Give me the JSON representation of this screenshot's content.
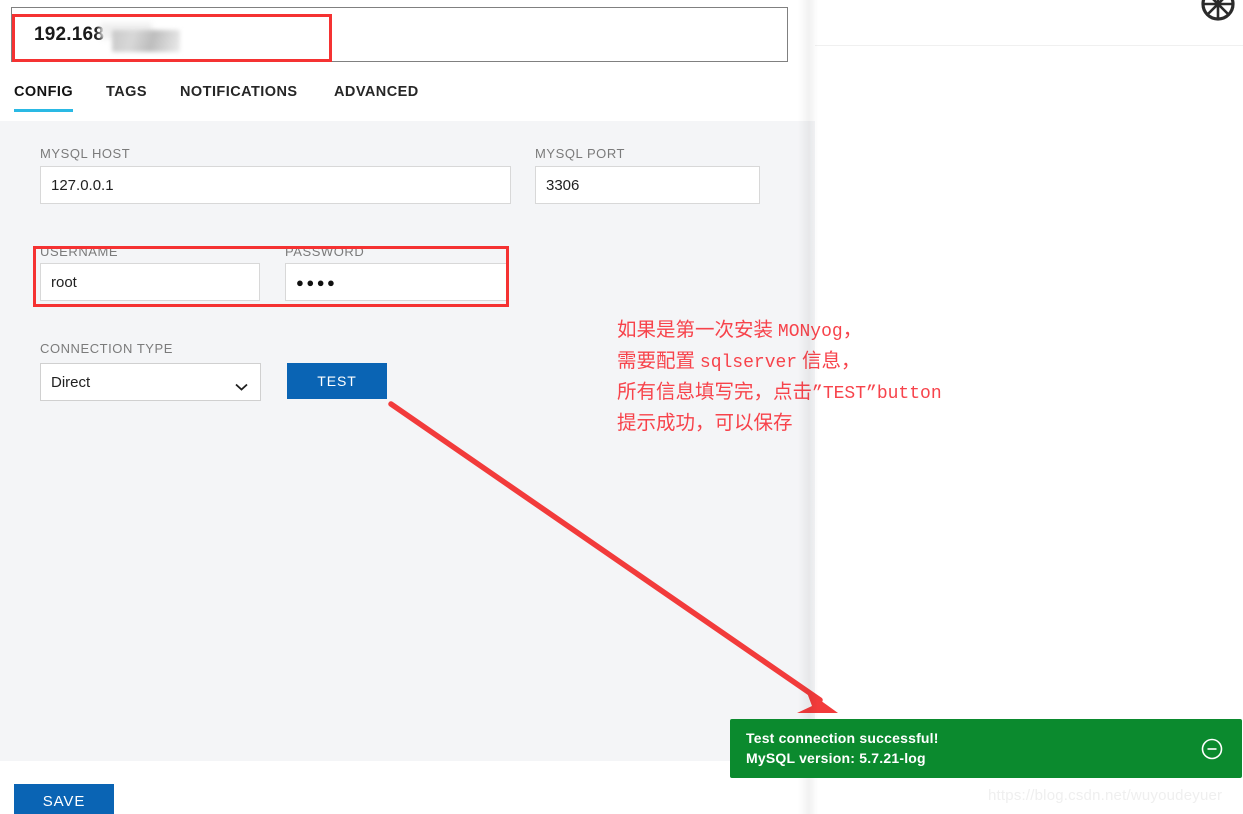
{
  "host_field": {
    "value": "192.168",
    "redacted": true
  },
  "tabs": [
    {
      "label": "CONFIG",
      "active": true
    },
    {
      "label": "TAGS",
      "active": false
    },
    {
      "label": "NOTIFICATIONS",
      "active": false
    },
    {
      "label": "ADVANCED",
      "active": false
    }
  ],
  "form": {
    "mysql_host": {
      "label": "MYSQL HOST",
      "value": "127.0.0.1"
    },
    "mysql_port": {
      "label": "MYSQL PORT",
      "value": "3306"
    },
    "username": {
      "label": "USERNAME",
      "value": "root"
    },
    "password": {
      "label": "PASSWORD",
      "value": "●●●●"
    },
    "connection_type": {
      "label": "CONNECTION TYPE",
      "value": "Direct"
    }
  },
  "buttons": {
    "test_label": "TEST",
    "save_label": "SAVE"
  },
  "annotation": {
    "line1_a": "如果是第一次安装 ",
    "line1_b": "MONyog",
    "line1_c": "，",
    "line2_a": "需要配置 ",
    "line2_b": "sqlserver",
    "line2_c": " 信息，",
    "line3_a": "所有信息填写完，点击",
    "line3_b": "”TEST”button",
    "line4": "提示成功，可以保存",
    "color": "#f7434b"
  },
  "toast": {
    "line1": "Test connection successful!",
    "line2": "MySQL version: 5.7.21-log",
    "color": "#0b8a2e",
    "close_icon": "minus-circle-icon"
  },
  "watermark": "https://blog.csdn.net/wuyoudeyuer",
  "theme": {
    "accent_blue": "#0a64b4",
    "tab_underline": "#2ab9e4",
    "highlight_red": "#f53232",
    "form_bg": "#f4f5f7"
  }
}
